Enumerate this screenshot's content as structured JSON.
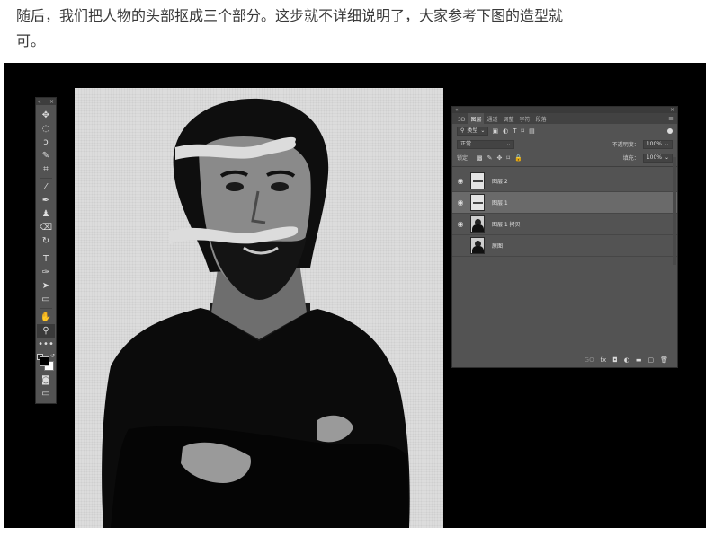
{
  "article": {
    "line1": "随后，我们把人物的头部抠成三个部分。这步就不详细说明了，大家参考下图的造型就",
    "line2": "可。"
  },
  "toolbar": {
    "collapse": "«",
    "close": "×",
    "tools": [
      {
        "name": "move-tool",
        "icon": "✥"
      },
      {
        "name": "marquee-tool",
        "icon": "◌"
      },
      {
        "name": "lasso-tool",
        "icon": "ↄ"
      },
      {
        "name": "quick-select-tool",
        "icon": "✎"
      },
      {
        "name": "crop-tool",
        "icon": "⌗"
      },
      {
        "name": "eyedropper-tool",
        "icon": "⁄"
      },
      {
        "name": "brush-tool",
        "icon": "✒"
      },
      {
        "name": "clone-stamp-tool",
        "icon": "♟"
      },
      {
        "name": "eraser-tool",
        "icon": "⌫"
      },
      {
        "name": "history-brush-tool",
        "icon": "↻"
      },
      {
        "name": "text-tool",
        "icon": "T"
      },
      {
        "name": "pen-tool",
        "icon": "✑"
      },
      {
        "name": "path-select-tool",
        "icon": "➤"
      },
      {
        "name": "rectangle-tool",
        "icon": "▭"
      },
      {
        "name": "hand-tool",
        "icon": "✋"
      },
      {
        "name": "zoom-tool",
        "icon": "⚲"
      }
    ],
    "more": "•••",
    "quick_mask": "◙",
    "screen_mode": "▭"
  },
  "panel": {
    "collapse": "«",
    "close": "×",
    "tabs": [
      "3D",
      "图层",
      "通道",
      "调整",
      "字符",
      "段落"
    ],
    "active_tab": "图层",
    "menu": "≡",
    "filter_type": "类型",
    "filter_icons": [
      "▣",
      "◐",
      "T",
      "⌑",
      "▤"
    ],
    "blend_mode": "正常",
    "opacity_label": "不透明度：",
    "opacity_value": "100%",
    "lock_label": "锁定：",
    "lock_icons": [
      "▩",
      "✎",
      "✥",
      "⌑",
      "🔒"
    ],
    "fill_label": "填充：",
    "fill_value": "100%",
    "layers": [
      {
        "name": "图层 2",
        "visible": true,
        "selected": false,
        "thumb": "strip"
      },
      {
        "name": "图层 1",
        "visible": true,
        "selected": true,
        "thumb": "strip"
      },
      {
        "name": "图层 1 拷贝",
        "visible": true,
        "selected": false,
        "thumb": "person"
      },
      {
        "name": "原图",
        "visible": false,
        "selected": false,
        "thumb": "person"
      }
    ],
    "bottom_icons": [
      "GO",
      "fx",
      "◘",
      "◐",
      "▬",
      "▢",
      "🗑"
    ]
  },
  "colors": {
    "panel_bg": "#535353",
    "canvas_bg": "#dcdcdc",
    "frame": "#000000"
  }
}
